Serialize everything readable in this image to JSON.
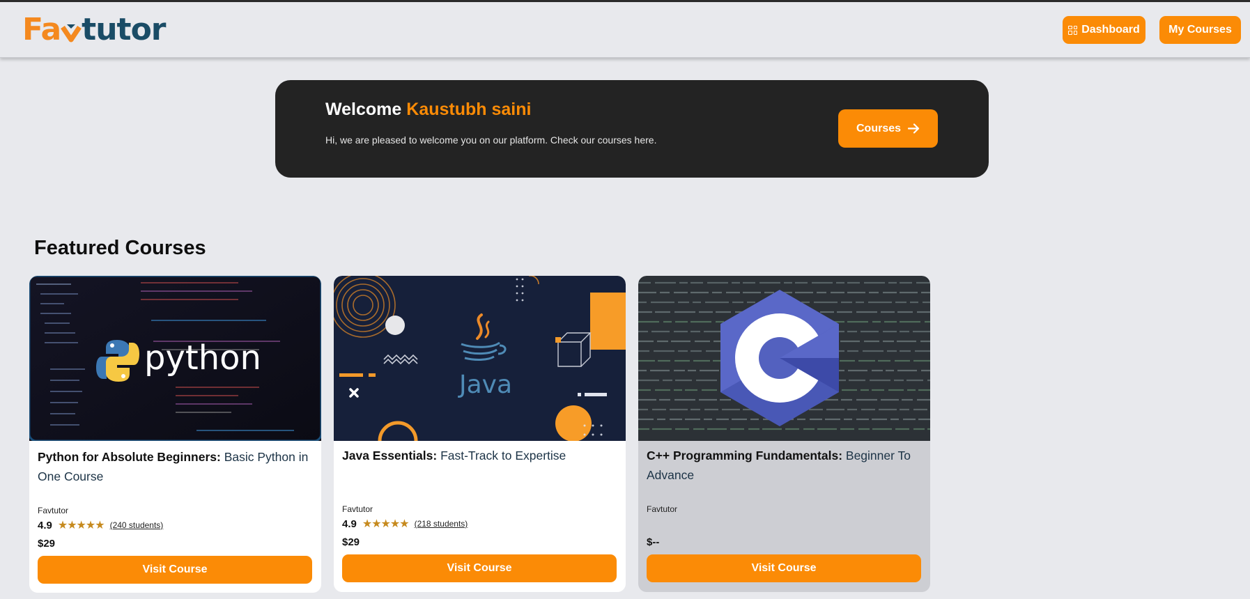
{
  "header": {
    "logo_part1": "Fa",
    "logo_part2": "tutor",
    "dashboard_label": "Dashboard",
    "mycourses_label": "My Courses"
  },
  "welcome": {
    "greeting": "Welcome",
    "user_name": "Kaustubh saini",
    "subtitle": "Hi, we are pleased to welcome you on our platform. Check our courses here.",
    "courses_label": "Courses"
  },
  "featured": {
    "title": "Featured Courses"
  },
  "courses": [
    {
      "title_bold": "Python for Absolute Beginners:",
      "title_rest": " Basic Python in One Course",
      "author": "Favtutor",
      "rating": "4.9",
      "stars": "★★★★★",
      "students": "(240 students)",
      "price": "$29",
      "button": "Visit Course",
      "image_text": "python"
    },
    {
      "title_bold": "Java Essentials:",
      "title_rest": " Fast-Track to Expertise",
      "author": "Favtutor",
      "rating": "4.9",
      "stars": "★★★★★",
      "students": "(218 students)",
      "price": "$29",
      "button": "Visit Course",
      "image_text": "Java"
    },
    {
      "title_bold": "C++ Programming Fundamentals:",
      "title_rest": " Beginner To Advance",
      "author": "Favtutor",
      "price": "$--",
      "button": "Visit Course"
    }
  ],
  "colors": {
    "accent": "#fb8b06",
    "banner_bg": "#232323",
    "page_bg": "#e8e9ed",
    "logo_blue": "#1a4c66"
  }
}
